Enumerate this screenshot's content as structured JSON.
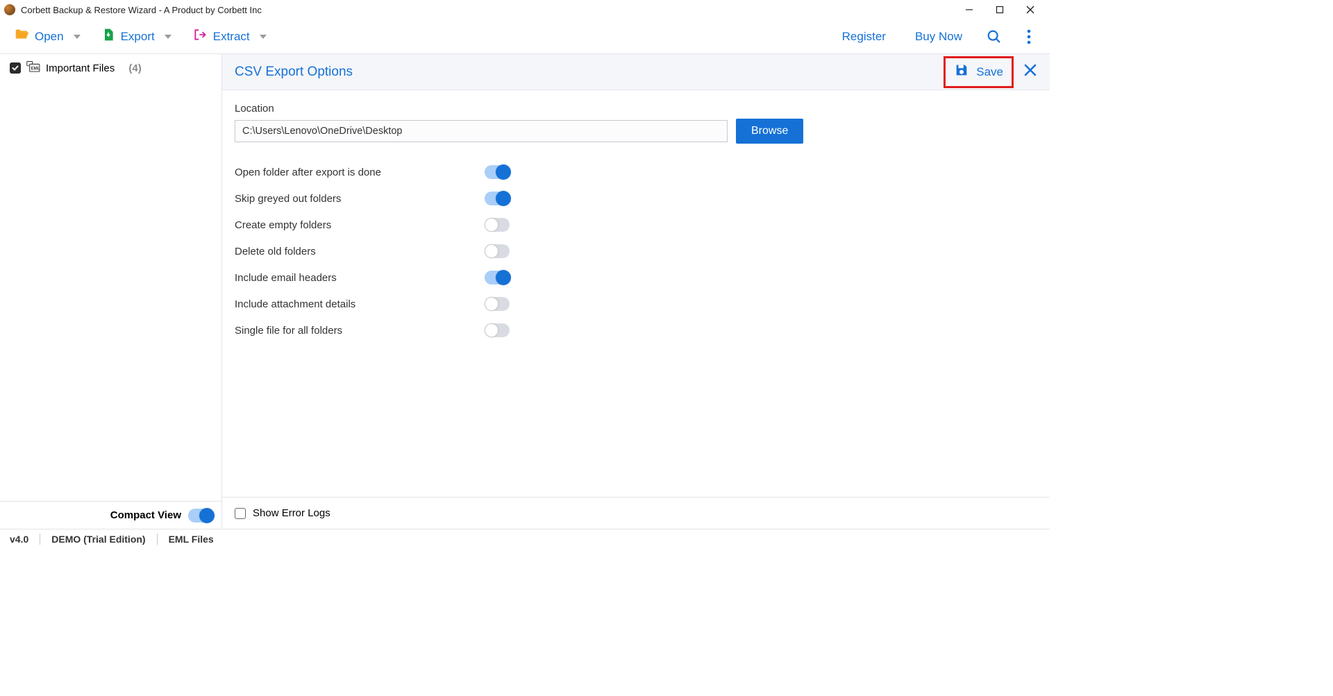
{
  "window": {
    "title": "Corbett Backup & Restore Wizard - A Product by Corbett Inc"
  },
  "toolbar": {
    "open": "Open",
    "export": "Export",
    "extract": "Extract",
    "register": "Register",
    "buy_now": "Buy Now"
  },
  "sidebar": {
    "item_label": "Important Files",
    "item_count": "(4)",
    "compact_view": "Compact View"
  },
  "panel": {
    "title": "CSV Export Options",
    "save": "Save",
    "location_label": "Location",
    "location_value": "C:\\Users\\Lenovo\\OneDrive\\Desktop",
    "browse": "Browse",
    "options": [
      {
        "label": "Open folder after export is done",
        "on": true
      },
      {
        "label": "Skip greyed out folders",
        "on": true
      },
      {
        "label": "Create empty folders",
        "on": false
      },
      {
        "label": "Delete old folders",
        "on": false
      },
      {
        "label": "Include email headers",
        "on": true
      },
      {
        "label": "Include attachment details",
        "on": false
      },
      {
        "label": "Single file for all folders",
        "on": false
      }
    ],
    "show_error_logs": "Show Error Logs"
  },
  "status": {
    "version": "v4.0",
    "edition": "DEMO (Trial Edition)",
    "files": "EML Files"
  }
}
